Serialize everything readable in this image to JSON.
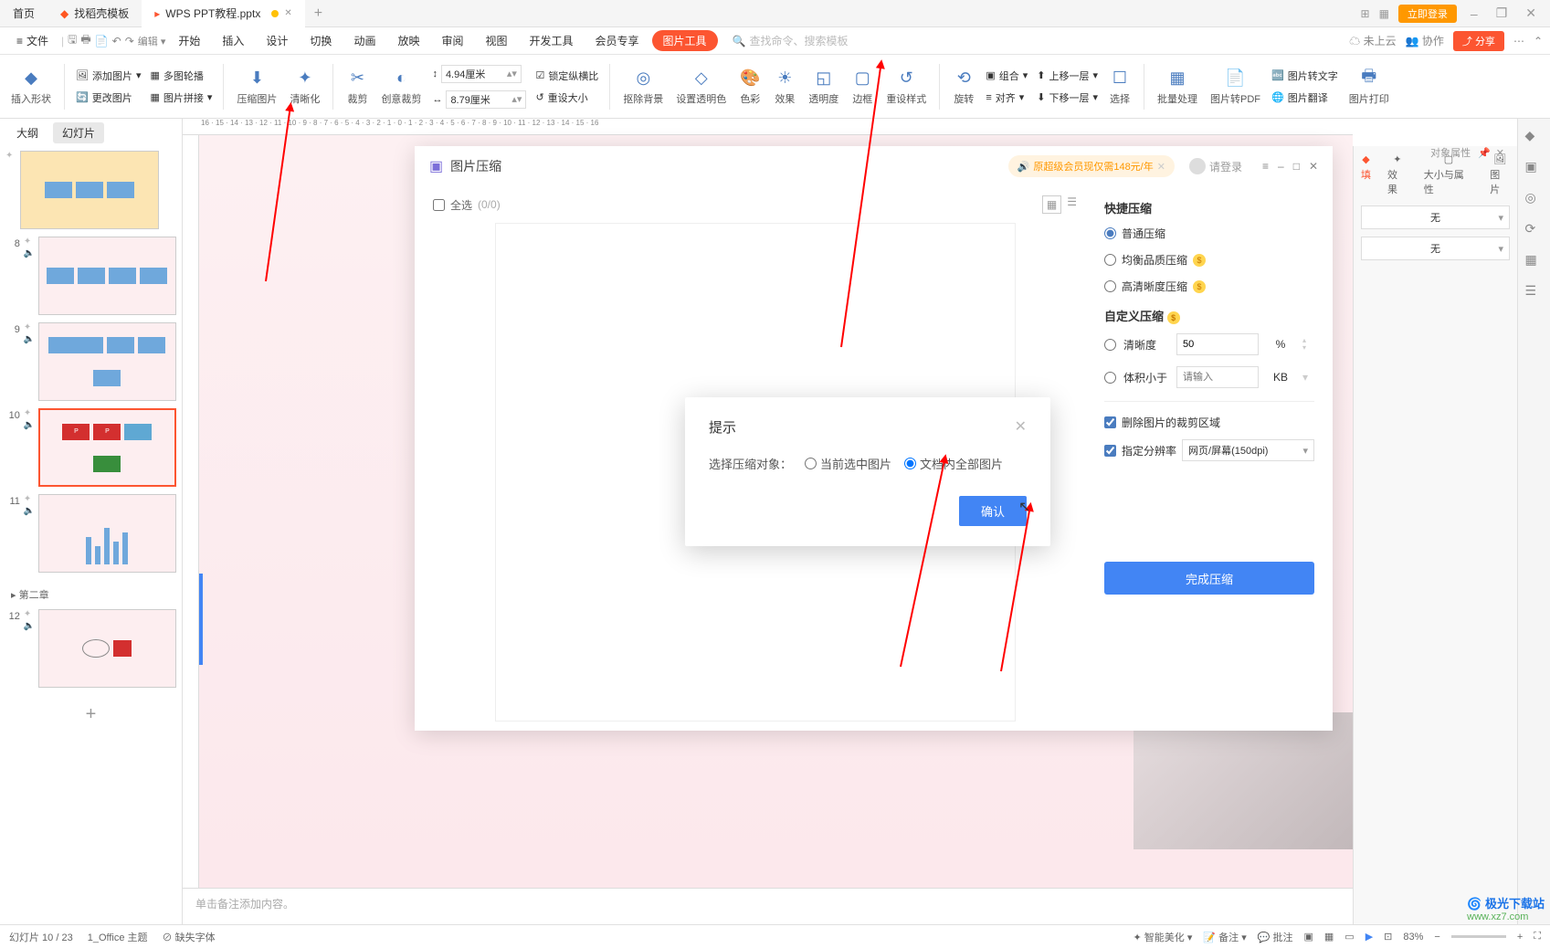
{
  "tabs": {
    "home": "首页",
    "template": "找稻壳模板",
    "file": "WPS PPT教程.pptx",
    "add": "+"
  },
  "topRight": {
    "login": "立即登录",
    "minimize": "–",
    "restore": "❐",
    "close": "✕"
  },
  "fileMenu": "文件",
  "menu": {
    "start": "开始",
    "insert": "插入",
    "design": "设计",
    "transition": "切换",
    "animation": "动画",
    "slideshow": "放映",
    "review": "审阅",
    "view": "视图",
    "devtools": "开发工具",
    "member": "会员专享",
    "imgtools": "图片工具",
    "searchPlaceholder": "查找命令、搜索模板",
    "cloud": "未上云",
    "collab": "协作",
    "share": "分享"
  },
  "ribbon": {
    "insertShape": "插入形状",
    "addImage": "添加图片",
    "multiCrop": "多图轮播",
    "changeImage": "更改图片",
    "imageStitch": "图片拼接",
    "compressImage": "压缩图片",
    "sharpen": "清晰化",
    "crop": "裁剪",
    "size": "创意裁剪",
    "width": "4.94厘米",
    "height": "8.79厘米",
    "lockRatio": "锁定纵横比",
    "resetSize": "重设大小",
    "removeBg": "抠除背景",
    "setTransparent": "设置透明色",
    "color": "色彩",
    "effect": "效果",
    "border": "边框",
    "resetStyle": "重设样式",
    "rotate": "旋转",
    "align": "对齐",
    "combine": "组合",
    "moveUp": "上移一层",
    "moveDown": "下移一层",
    "select": "选择",
    "transparency": "透明度",
    "batch": "批量处理",
    "toPdf": "图片转PDF",
    "toText": "图片转文字",
    "translate": "图片翻译",
    "print": "图片打印"
  },
  "leftPanel": {
    "outline": "大纲",
    "slides": "幻灯片",
    "chapter2": "第二章",
    "nums": [
      "8",
      "9",
      "10",
      "11",
      "12"
    ]
  },
  "rightPanel": {
    "objectProps": "对象属性",
    "tabs": {
      "fill": "填",
      "effect": "效果",
      "sizeProps": "大小与属性",
      "image": "图片"
    },
    "none": "无"
  },
  "dialog": {
    "title": "图片压缩",
    "promo": "原超级会员现仅需148元/年",
    "login": "请登录",
    "selectAll": "全选",
    "count": "(0/0)",
    "quickCompress": "快捷压缩",
    "normal": "普通压缩",
    "balanced": "均衡品质压缩",
    "hd": "高清晰度压缩",
    "customCompress": "自定义压缩",
    "clarity": "清晰度",
    "clarityVal": "50",
    "clarityUnit": "%",
    "sizeLess": "体积小于",
    "sizePlaceholder": "请输入",
    "sizeUnit": "KB",
    "deleteCrop": "删除图片的裁剪区域",
    "setDpi": "指定分辨率",
    "dpiValue": "网页/屏幕(150dpi)",
    "complete": "完成压缩"
  },
  "prompt": {
    "title": "提示",
    "label": "选择压缩对象：",
    "current": "当前选中图片",
    "allInDoc": "文档内全部图片",
    "confirm": "确认"
  },
  "notes": "单击备注添加内容。",
  "status": {
    "slideInfo": "幻灯片 10 / 23",
    "theme": "1_Office 主题",
    "missingFont": "缺失字体",
    "beautify": "智能美化",
    "notesBtn": "备注",
    "comments": "批注",
    "zoom": "83%"
  },
  "watermark": {
    "line1": "极光下载站",
    "line2": "www.xz7.com"
  }
}
